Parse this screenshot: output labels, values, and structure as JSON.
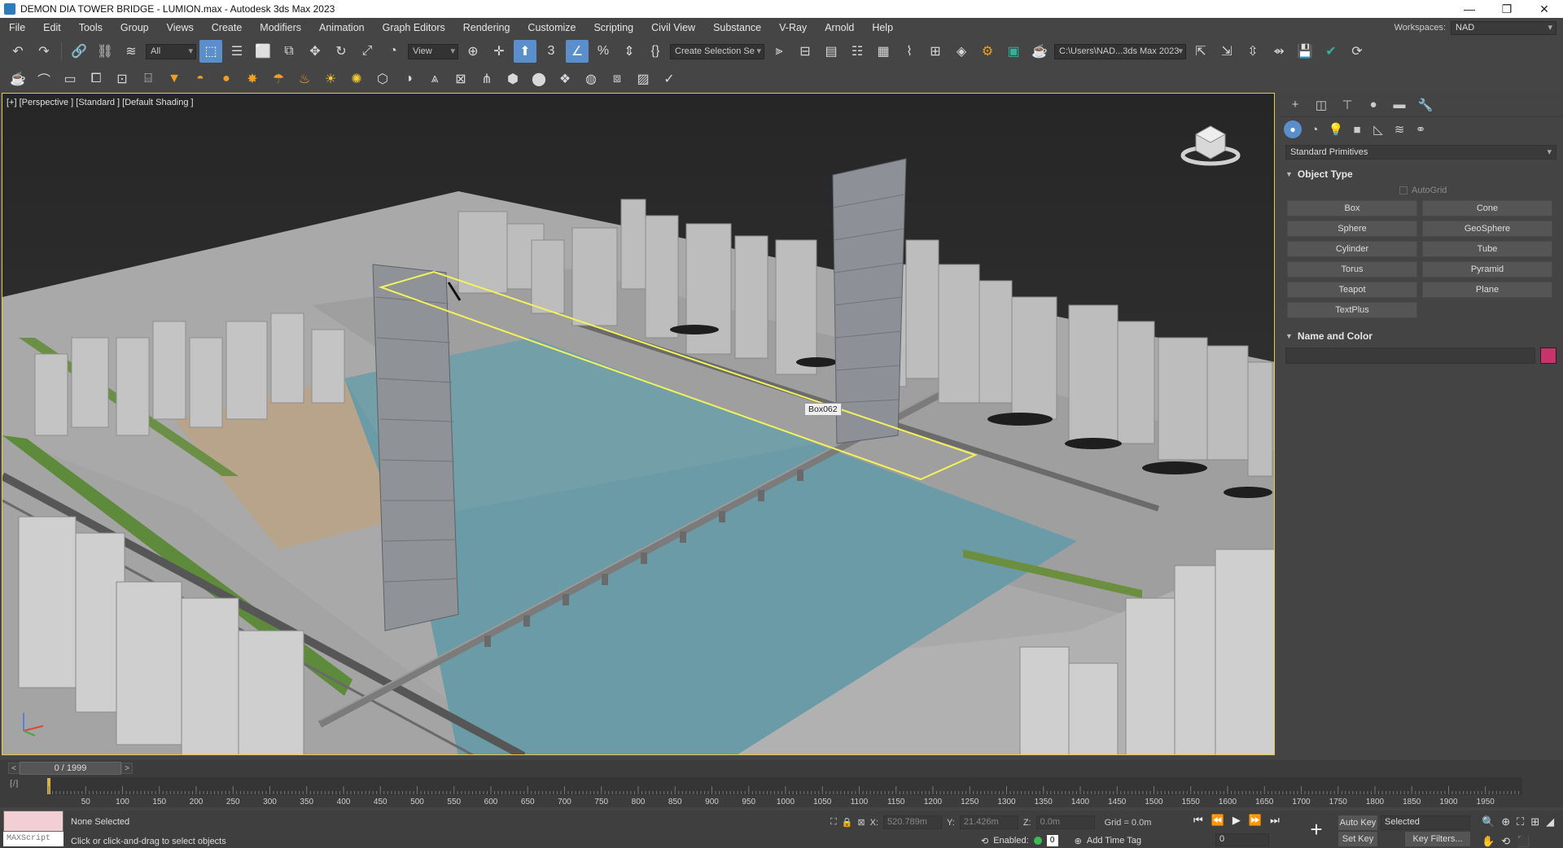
{
  "window": {
    "title": "DEMON DIA TOWER BRIDGE - LUMION.max - Autodesk 3ds Max 2023"
  },
  "menu": [
    "File",
    "Edit",
    "Tools",
    "Group",
    "Views",
    "Create",
    "Modifiers",
    "Animation",
    "Graph Editors",
    "Rendering",
    "Customize",
    "Scripting",
    "Civil View",
    "Substance",
    "V-Ray",
    "Arnold",
    "Help"
  ],
  "workspaces": {
    "label": "Workspaces:",
    "value": "NAD"
  },
  "toolbar": {
    "filter": "All",
    "refcoord": "View",
    "selection_set": "Create Selection Se",
    "project_path": "C:\\Users\\NAD...3ds Max 2023"
  },
  "viewport": {
    "label": "[+] [Perspective ] [Standard ] [Default Shading ]",
    "object_tag": "Box062"
  },
  "command_panel": {
    "category": "Standard Primitives",
    "object_type_title": "Object Type",
    "autogrid": "AutoGrid",
    "buttons": [
      "Box",
      "Cone",
      "Sphere",
      "GeoSphere",
      "Cylinder",
      "Tube",
      "Torus",
      "Pyramid",
      "Teapot",
      "Plane",
      "TextPlus"
    ],
    "name_color_title": "Name and Color",
    "swatch_color": "#c8336b"
  },
  "timeline": {
    "frame": "0 / 1999",
    "ticks": [
      "50",
      "100",
      "150",
      "200",
      "250",
      "300",
      "350",
      "400",
      "450",
      "500",
      "550",
      "600",
      "650",
      "700",
      "750",
      "800",
      "850",
      "900",
      "950",
      "1000",
      "1050",
      "1100",
      "1150",
      "1200",
      "1250",
      "1300",
      "1350",
      "1400",
      "1450",
      "1500",
      "1550",
      "1600",
      "1650",
      "1700",
      "1750",
      "1800",
      "1850",
      "1900",
      "1950"
    ]
  },
  "status": {
    "maxscript": "MAXScript",
    "selection": "None Selected",
    "prompt": "Click or click-and-drag to select objects",
    "x_label": "X:",
    "x_value": "520.789m",
    "y_label": "Y:",
    "y_value": "21.426m",
    "z_label": "Z:",
    "z_value": "0.0m",
    "grid": "Grid = 0.0m",
    "enabled_label": "Enabled:",
    "enabled_count": "0",
    "add_time_tag": "Add Time Tag",
    "auto_key": "Auto Key",
    "set_key": "Set Key",
    "selected": "Selected",
    "key_filters": "Key Filters...",
    "frame_input": "0"
  }
}
